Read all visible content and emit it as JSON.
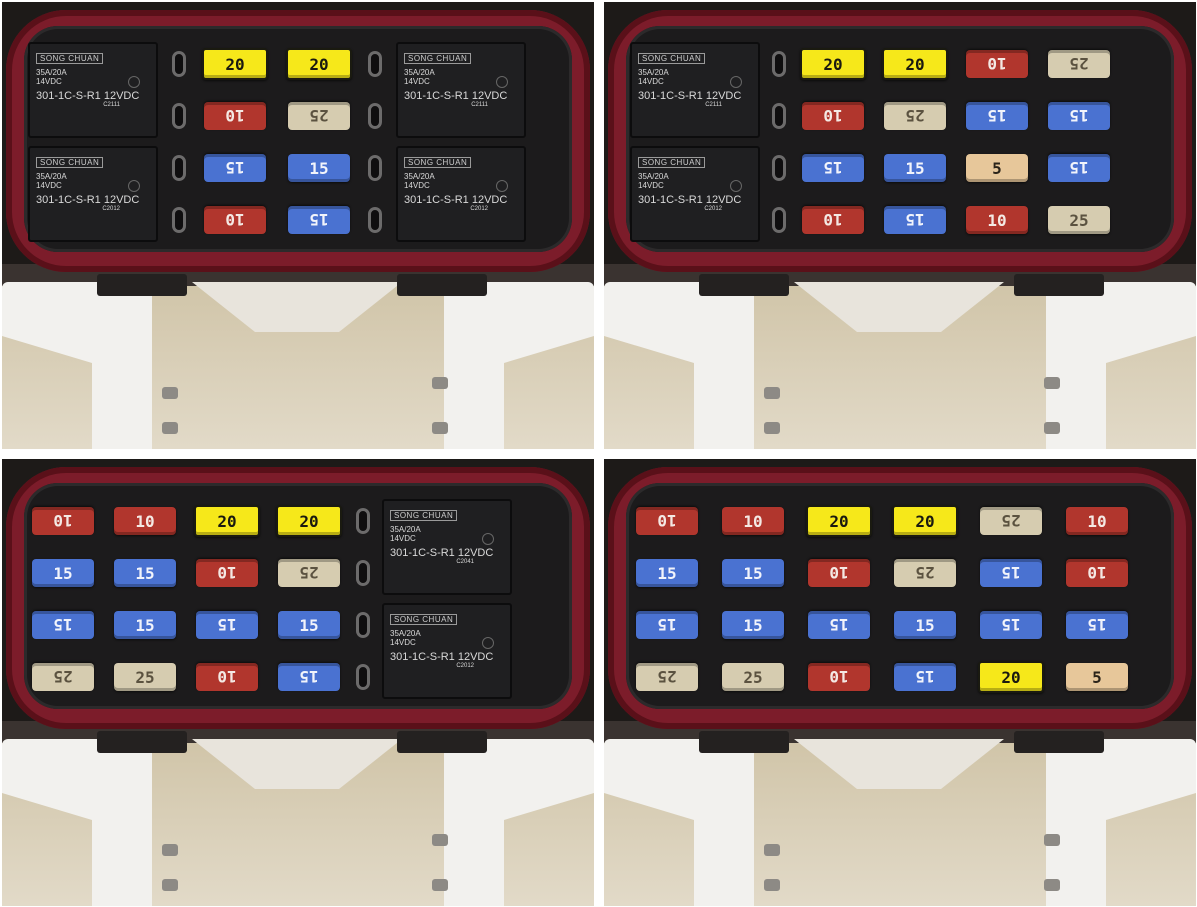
{
  "photos": [
    {
      "relays_left": [
        {
          "logo": "SONG CHUAN",
          "rating": "35A/20A\n14VDC",
          "model": "301-1C-S-R1  12VDC",
          "code": "C2111"
        },
        {
          "logo": "SONG CHUAN",
          "rating": "35A/20A\n14VDC",
          "model": "301-1C-S-R1  12VDC",
          "code": "C2012"
        }
      ],
      "relays_right": [
        {
          "logo": "SONG CHUAN",
          "rating": "35A/20A\n14VDC",
          "model": "301-1C-S-R1  12VDC",
          "code": "C2111"
        },
        {
          "logo": "SONG CHUAN",
          "rating": "35A/20A\n14VDC",
          "model": "301-1C-S-R1  12VDC",
          "code": "C2012"
        }
      ],
      "fuses": [
        [
          "20",
          "20"
        ],
        [
          "10",
          "25"
        ],
        [
          "15",
          "15"
        ],
        [
          "10",
          "15"
        ]
      ]
    },
    {
      "relays_left": [
        {
          "logo": "SONG CHUAN",
          "rating": "35A/20A\n14VDC",
          "model": "301-1C-S-R1  12VDC",
          "code": "C2111"
        },
        {
          "logo": "SONG CHUAN",
          "rating": "35A/20A\n14VDC",
          "model": "301-1C-S-R1  12VDC",
          "code": "C2012"
        }
      ],
      "fuses": [
        [
          "20",
          "20",
          "10",
          "25"
        ],
        [
          "10",
          "25",
          "15",
          "15"
        ],
        [
          "15",
          "15",
          "5",
          "15"
        ],
        [
          "10",
          "15",
          "10",
          "25"
        ]
      ]
    },
    {
      "relays_right": [
        {
          "logo": "SONG CHUAN",
          "rating": "35A/20A\n14VDC",
          "model": "301-1C-S-R1  12VDC",
          "code": "C2041"
        },
        {
          "logo": "SONG CHUAN",
          "rating": "35A/20A\n14VDC",
          "model": "301-1C-S-R1  12VDC",
          "code": "C2012"
        }
      ],
      "fuses": [
        [
          "10",
          "10",
          "20",
          "20"
        ],
        [
          "15",
          "15",
          "10",
          "25"
        ],
        [
          "15",
          "15",
          "15",
          "15"
        ],
        [
          "25",
          "25",
          "10",
          "15"
        ]
      ]
    },
    {
      "fuses": [
        [
          "10",
          "10",
          "20",
          "20",
          "25",
          "10"
        ],
        [
          "15",
          "15",
          "10",
          "25",
          "15",
          "10"
        ],
        [
          "15",
          "15",
          "15",
          "15",
          "15",
          "15"
        ],
        [
          "25",
          "25",
          "10",
          "15",
          "20",
          "5"
        ]
      ]
    }
  ]
}
